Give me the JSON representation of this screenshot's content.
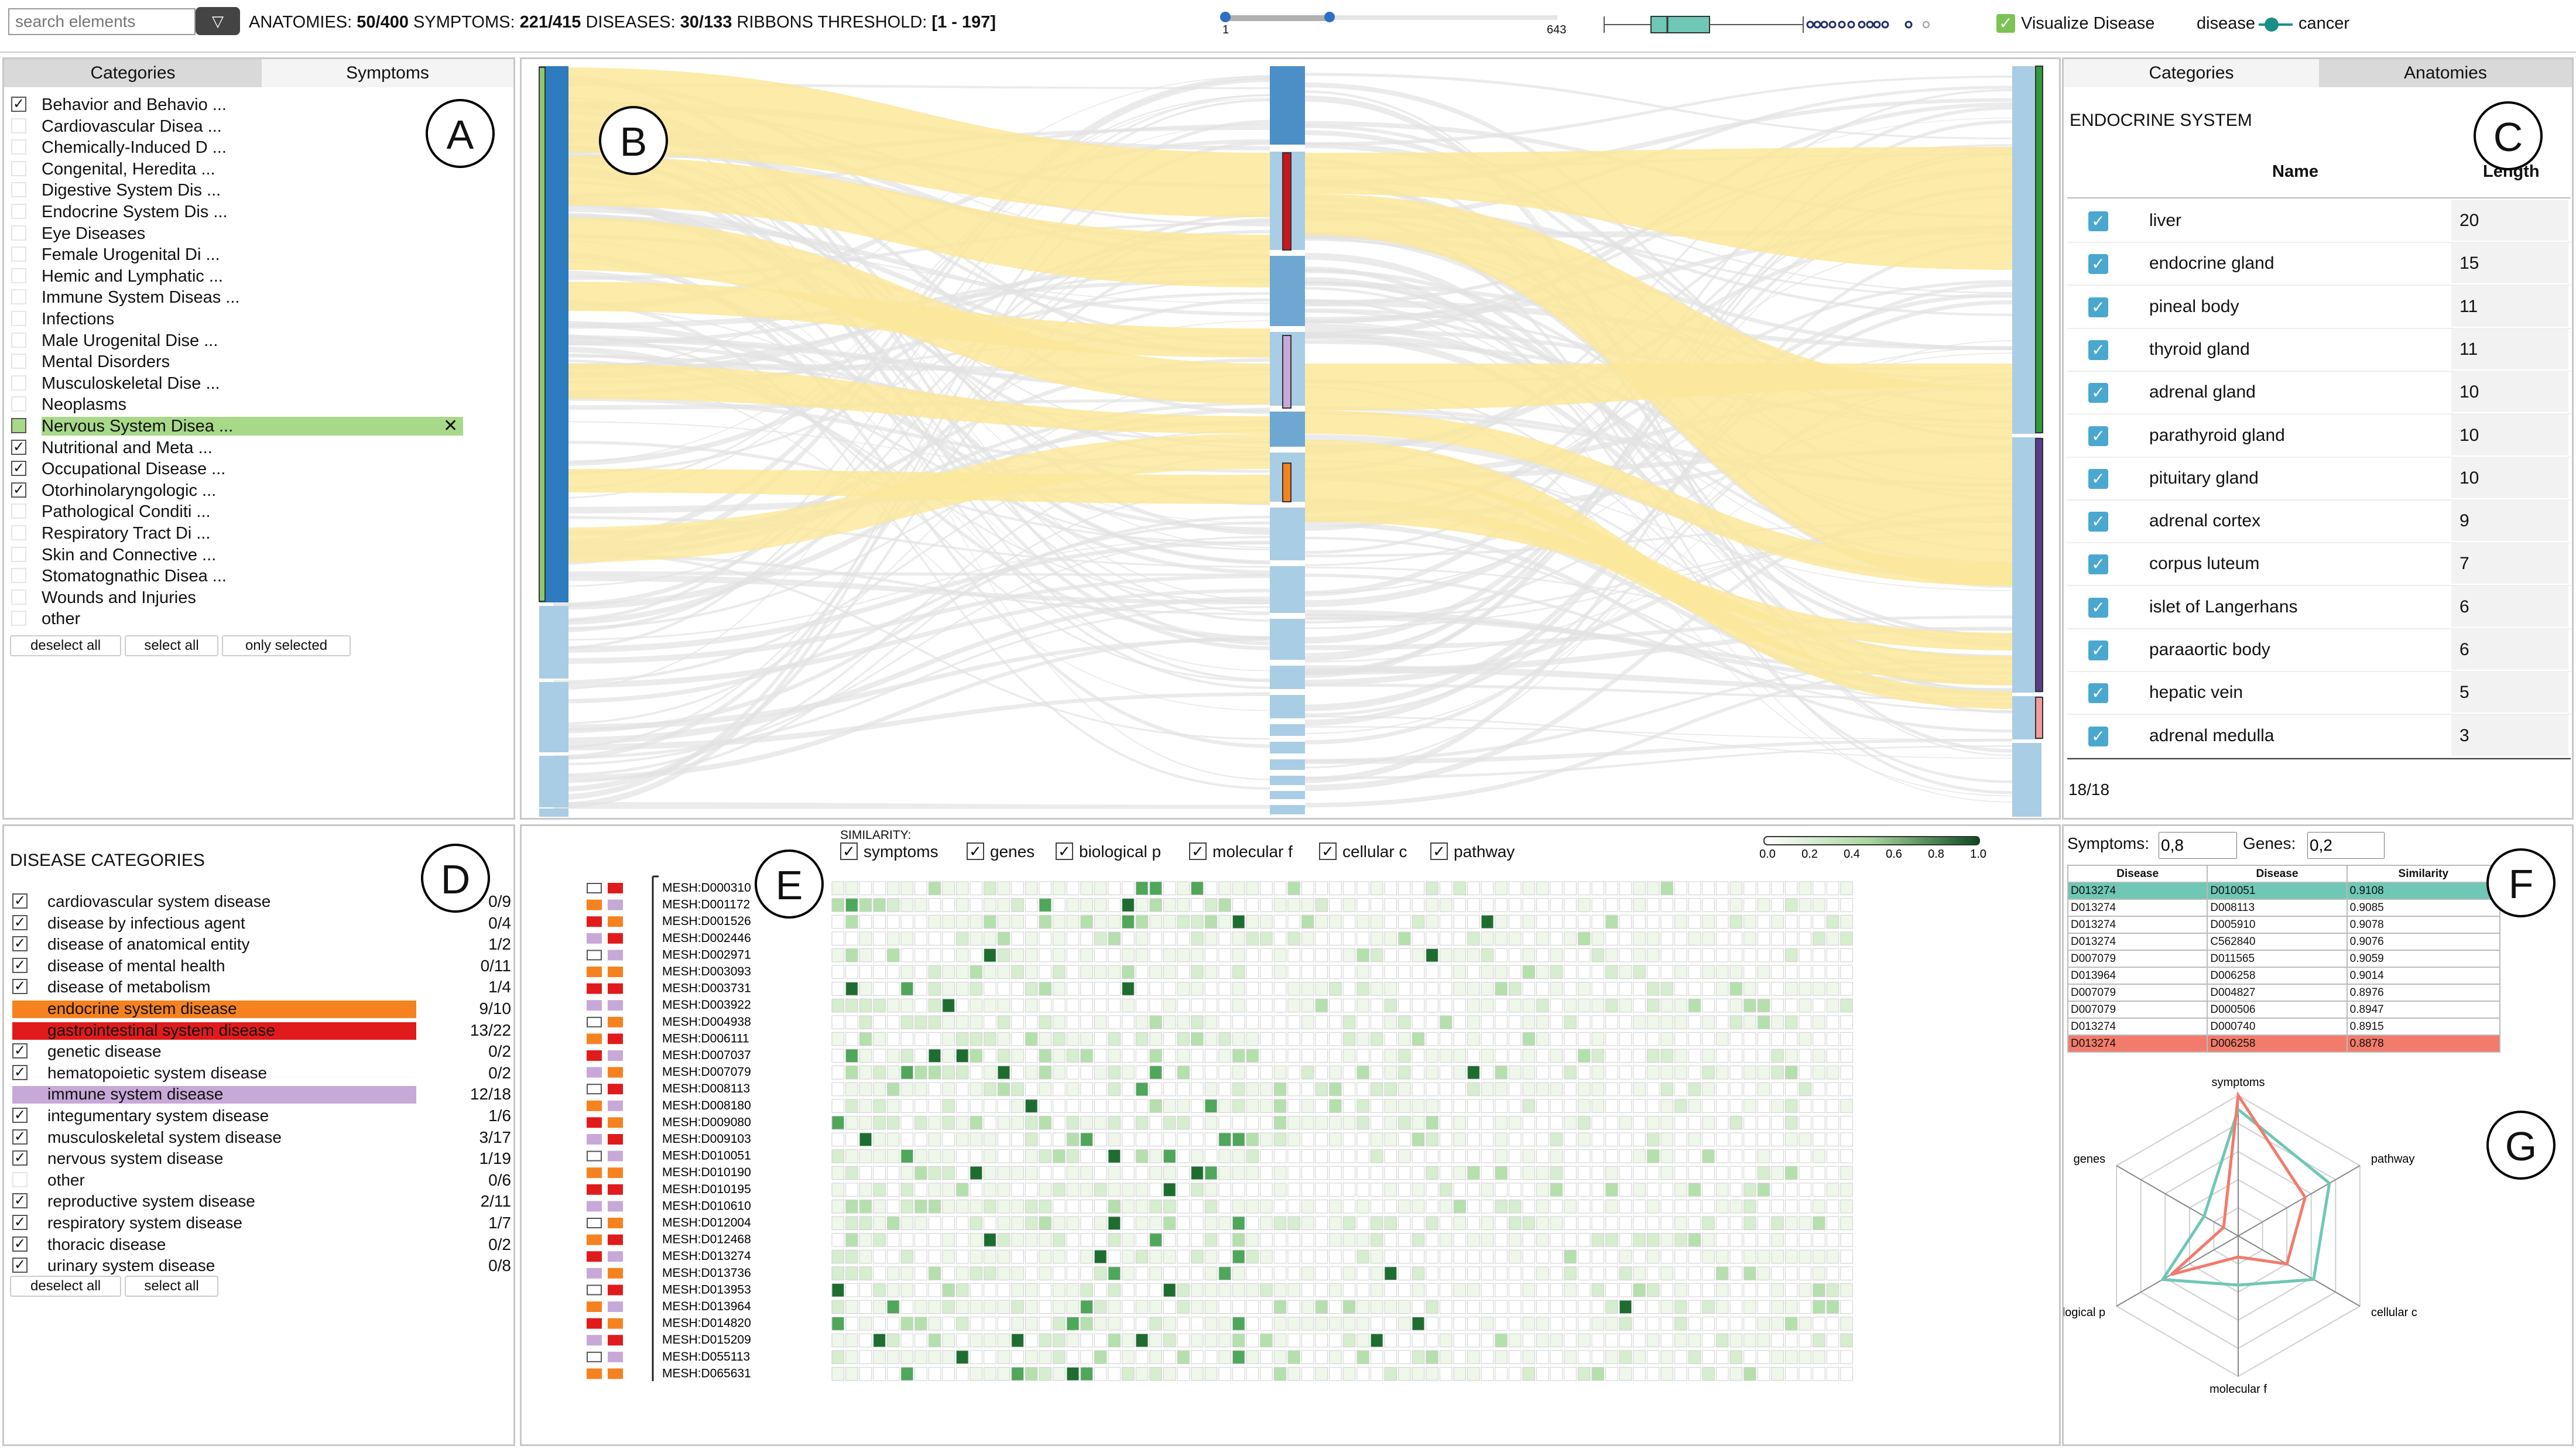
{
  "topbar": {
    "search_placeholder": "search elements",
    "stats_prefix": "ANATOMIES: ",
    "anatomies": "50/400",
    "symptoms_label": " SYMPTOMS: ",
    "symptoms": "221/415",
    "diseases_label": " DISEASES: ",
    "diseases": "30/133",
    "ribbons_label": "  RIBBONS THRESHOLD: ",
    "ribbons": "[1 - 197]",
    "slider_min": "1",
    "slider_max": "643",
    "visualize_label": "Visualize Disease",
    "legend_disease": "disease",
    "legend_cancer": "cancer"
  },
  "panelA": {
    "tabs": [
      "Categories",
      "Symptoms"
    ],
    "active_tab": "Categories",
    "circle": "A",
    "items": [
      {
        "label": "Behavior and Behavio ...",
        "checked": true
      },
      {
        "label": "Cardiovascular Disea ...",
        "checked": false
      },
      {
        "label": "Chemically-Induced D ...",
        "checked": false
      },
      {
        "label": "Congenital, Heredita ...",
        "checked": false
      },
      {
        "label": "Digestive System Dis ...",
        "checked": false
      },
      {
        "label": "Endocrine System Dis ...",
        "checked": false
      },
      {
        "label": "Eye Diseases",
        "checked": false
      },
      {
        "label": "Female Urogenital Di ...",
        "checked": false
      },
      {
        "label": "Hemic and Lymphatic ...",
        "checked": false
      },
      {
        "label": "Immune System Diseas ...",
        "checked": false
      },
      {
        "label": "Infections",
        "checked": false
      },
      {
        "label": "Male Urogenital Dise ...",
        "checked": false
      },
      {
        "label": "Mental Disorders",
        "checked": false
      },
      {
        "label": "Musculoskeletal Dise ...",
        "checked": false
      },
      {
        "label": "Neoplasms",
        "checked": false
      },
      {
        "label": "Nervous System Disea ...",
        "checked": false,
        "highlight": true
      },
      {
        "label": "Nutritional and Meta ...",
        "checked": true
      },
      {
        "label": "Occupational Disease ...",
        "checked": true
      },
      {
        "label": "Otorhinolaryngologic ...",
        "checked": true
      },
      {
        "label": "Pathological Conditi ...",
        "checked": false
      },
      {
        "label": "Respiratory Tract Di ...",
        "checked": false
      },
      {
        "label": "Skin and Connective ...",
        "checked": false
      },
      {
        "label": "Stomatognathic Disea ...",
        "checked": false
      },
      {
        "label": "Wounds and Injuries",
        "checked": false
      },
      {
        "label": "other",
        "checked": false
      }
    ],
    "buttons": [
      "deselect all",
      "select all",
      "only selected"
    ]
  },
  "panelB": {
    "circle": "B"
  },
  "panelC": {
    "tabs": [
      "Categories",
      "Anatomies"
    ],
    "active_tab": "Anatomies",
    "circle": "C",
    "title": "ENDOCRINE SYSTEM",
    "col_name": "Name",
    "col_length": "Length",
    "rows": [
      [
        "liver",
        "20"
      ],
      [
        "endocrine gland",
        "15"
      ],
      [
        "pineal body",
        "11"
      ],
      [
        "thyroid gland",
        "11"
      ],
      [
        "adrenal gland",
        "10"
      ],
      [
        "parathyroid gland",
        "10"
      ],
      [
        "pituitary gland",
        "10"
      ],
      [
        "adrenal cortex",
        "9"
      ],
      [
        "corpus luteum",
        "7"
      ],
      [
        "islet of Langerhans",
        "6"
      ],
      [
        "paraaortic body",
        "6"
      ],
      [
        "hepatic vein",
        "5"
      ],
      [
        "adrenal medulla",
        "3"
      ]
    ],
    "footer": "18/18"
  },
  "panelD": {
    "title": "DISEASE CATEGORIES",
    "circle": "D",
    "items": [
      {
        "label": "cardiovascular system disease",
        "count": "0/9",
        "state": "checked"
      },
      {
        "label": "disease by infectious agent",
        "count": "0/4",
        "state": "checked"
      },
      {
        "label": "disease of anatomical entity",
        "count": "1/2",
        "state": "checked"
      },
      {
        "label": "disease of mental health",
        "count": "0/11",
        "state": "checked"
      },
      {
        "label": "disease of metabolism",
        "count": "1/4",
        "state": "checked"
      },
      {
        "label": "endocrine system disease",
        "count": "9/10",
        "state": "color",
        "color": "#f5821f"
      },
      {
        "label": "gastrointestinal system disease",
        "count": "13/22",
        "state": "color",
        "color": "#e11b1b"
      },
      {
        "label": "genetic disease",
        "count": "0/2",
        "state": "checked"
      },
      {
        "label": "hematopoietic system disease",
        "count": "0/2",
        "state": "checked"
      },
      {
        "label": "immune system disease",
        "count": "12/18",
        "state": "color",
        "color": "#c8a8d8"
      },
      {
        "label": "integumentary system disease",
        "count": "1/6",
        "state": "checked"
      },
      {
        "label": "musculoskeletal system disease",
        "count": "3/17",
        "state": "checked"
      },
      {
        "label": "nervous system disease",
        "count": "1/19",
        "state": "checked"
      },
      {
        "label": "other",
        "count": "0/6",
        "state": "none"
      },
      {
        "label": "reproductive system disease",
        "count": "2/11",
        "state": "checked"
      },
      {
        "label": "respiratory system disease",
        "count": "1/7",
        "state": "checked"
      },
      {
        "label": "thoracic disease",
        "count": "0/2",
        "state": "checked"
      },
      {
        "label": "urinary system disease",
        "count": "0/8",
        "state": "checked"
      }
    ],
    "buttons": [
      "deselect all",
      "select all"
    ]
  },
  "panelE": {
    "circle": "E",
    "similarity_label": "SIMILARITY:",
    "checks": [
      "symptoms",
      "genes",
      "biological p",
      "molecular f",
      "cellular c",
      "pathway"
    ],
    "scale_ticks": [
      "0.0",
      "0.2",
      "0.4",
      "0.6",
      "0.8",
      "1.0"
    ],
    "rows": [
      "MESH:D000310",
      "MESH:D001172",
      "MESH:D001526",
      "MESH:D002446",
      "MESH:D002971",
      "MESH:D003093",
      "MESH:D003731",
      "MESH:D003922",
      "MESH:D004938",
      "MESH:D006111",
      "MESH:D007037",
      "MESH:D007079",
      "MESH:D008113",
      "MESH:D008180",
      "MESH:D009080",
      "MESH:D009103",
      "MESH:D010051",
      "MESH:D010190",
      "MESH:D010195",
      "MESH:D010610",
      "MESH:D012004",
      "MESH:D012468",
      "MESH:D013274",
      "MESH:D013736",
      "MESH:D013953",
      "MESH:D013964",
      "MESH:D014820",
      "MESH:D015209",
      "MESH:D055113",
      "MESH:D065631"
    ]
  },
  "panelF": {
    "circle": "F",
    "symptoms_label": "Symptoms:",
    "symptoms_value": "0,8",
    "genes_label": "Genes:",
    "genes_value": "0,2",
    "headers": [
      "Disease",
      "Disease",
      "Similarity"
    ],
    "rows": [
      [
        "D013274",
        "D010051",
        "0.9108"
      ],
      [
        "D013274",
        "D008113",
        "0.9085"
      ],
      [
        "D013274",
        "D005910",
        "0.9078"
      ],
      [
        "D013274",
        "C562840",
        "0.9076"
      ],
      [
        "D007079",
        "D011565",
        "0.9059"
      ],
      [
        "D013964",
        "D006258",
        "0.9014"
      ],
      [
        "D007079",
        "D004827",
        "0.8976"
      ],
      [
        "D007079",
        "D000506",
        "0.8947"
      ],
      [
        "D013274",
        "D000740",
        "0.8915"
      ],
      [
        "D013274",
        "D006258",
        "0.8878"
      ]
    ],
    "row_colors": {
      "0": "#6fc7b5",
      "9": "#f27b6b"
    }
  },
  "panelG": {
    "circle": "G",
    "axes": [
      "symptoms",
      "pathway",
      "cellular c",
      "molecular f",
      "biological p",
      "genes"
    ],
    "series": [
      {
        "values": [
          1.0,
          0.55,
          0.4,
          0.15,
          0.55,
          0.12
        ],
        "color": "#f27b6b"
      },
      {
        "values": [
          0.9,
          0.75,
          0.62,
          0.35,
          0.62,
          0.28
        ],
        "color": "#6fc7b5"
      }
    ]
  },
  "colors": {
    "ribbon_yellow": "#fbe89a",
    "ribbon_grey": "#e3e3e3",
    "blue_dark": "#2f7bbf",
    "blue_light": "#a9cde4",
    "green_bar": "#2e9a3a",
    "purple_bar": "#5a3b8a"
  }
}
